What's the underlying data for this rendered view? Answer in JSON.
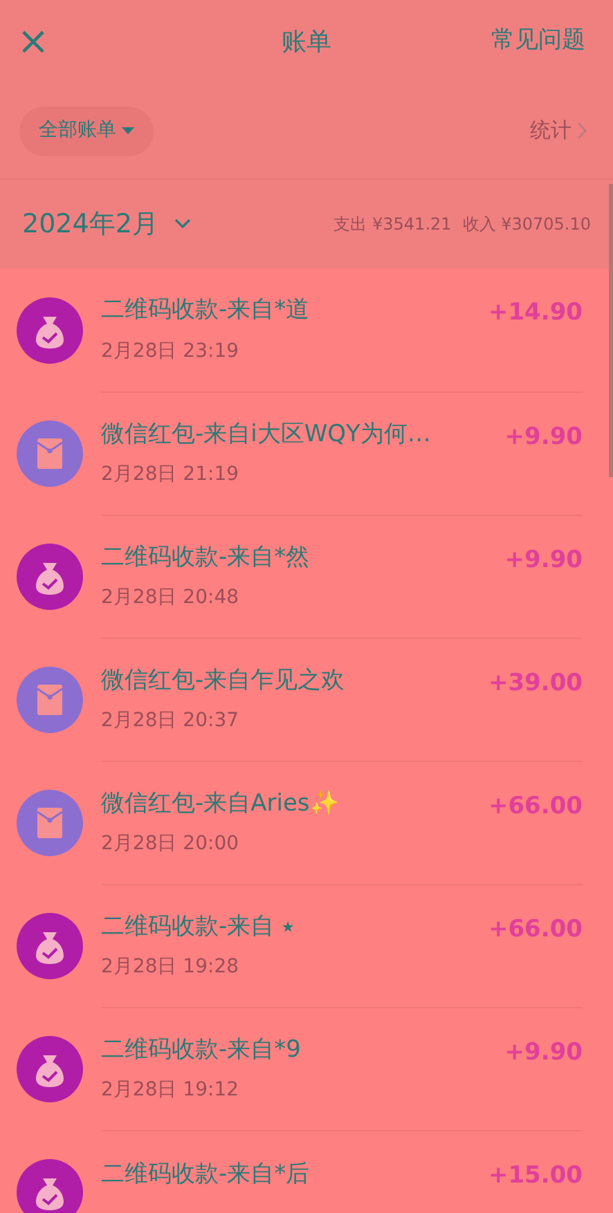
{
  "header": {
    "close": "×",
    "title": "账单",
    "help": "常见问题"
  },
  "filter": {
    "label": "全部账单",
    "stats": "统计"
  },
  "month": {
    "label": "2024年2月",
    "expense": "支出 ¥3541.21",
    "income": "收入 ¥30705.10"
  },
  "transactions": [
    {
      "kind": "qr",
      "title": "二维码收款-来自*道",
      "time": "2月28日 23:19",
      "amount": "+14.90"
    },
    {
      "kind": "hongbao",
      "title": "微信红包-来自i大区WQY为何…",
      "time": "2月28日 21:19",
      "amount": "+9.90"
    },
    {
      "kind": "qr",
      "title": "二维码收款-来自*然",
      "time": "2月28日 20:48",
      "amount": "+9.90"
    },
    {
      "kind": "hongbao",
      "title": "微信红包-来自乍见之欢",
      "time": "2月28日 20:37",
      "amount": "+39.00"
    },
    {
      "kind": "hongbao",
      "title": "微信红包-来自Aries✨",
      "time": "2月28日 20:00",
      "amount": "+66.00"
    },
    {
      "kind": "qr",
      "title": "二维码收款-来自 ⭑",
      "time": "2月28日 19:28",
      "amount": "+66.00"
    },
    {
      "kind": "qr",
      "title": "二维码收款-来自*9",
      "time": "2月28日 19:12",
      "amount": "+9.90"
    },
    {
      "kind": "qr",
      "title": "二维码收款-来自*后",
      "amount": "+15.00"
    }
  ]
}
